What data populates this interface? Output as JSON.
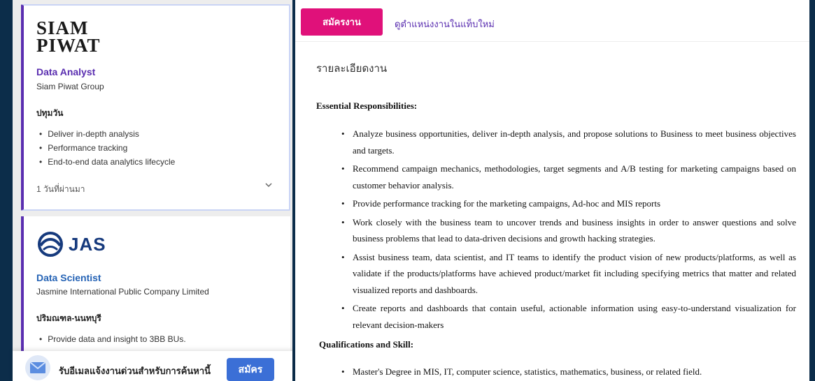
{
  "job_list": {
    "cards": [
      {
        "logo_text": "SIAM\nPIWAT",
        "title": "Data Analyst",
        "company": "Siam Piwat Group",
        "location": "ปทุมวัน",
        "highlights": [
          "Deliver in-depth analysis",
          "Performance tracking",
          "End-to-end data analytics lifecycle"
        ],
        "posted": "1 วันที่ผ่านมา"
      },
      {
        "logo_text": "JAS",
        "title": "Data Scientist",
        "company": "Jasmine International Public Company Limited",
        "location": "ปริมณฑล-นนทบุรี",
        "highlights": [
          "Provide data and insight to 3BB BUs."
        ]
      }
    ]
  },
  "subscribe": {
    "text": "รับอีเมลแจ้งงานด่วนสำหรับการค้นหานี้",
    "button": "สมัคร"
  },
  "detail": {
    "apply_button": "สมัครงาน",
    "new_tab_link": "ดูตำแหน่งงานในแท็บใหม่",
    "section_title": "รายละเอียดงาน",
    "responsibilities_heading": "Essential Responsibilities:",
    "responsibilities": [
      "Analyze business opportunities, deliver in-depth analysis, and propose solutions to Business to meet business objectives and targets.",
      "Recommend campaign mechanics, methodologies, target segments and A/B testing for marketing campaigns based on customer behavior analysis.",
      "Provide performance tracking for the marketing campaigns, Ad-hoc and MIS reports",
      "Work closely with the business team to uncover trends and business insights in order to answer questions and solve business problems that lead to data-driven decisions and growth hacking strategies.",
      "Assist business team, data scientist, and IT teams to identify the product vision of new products/platforms, as well as validate if the products/platforms have achieved product/market fit including specifying metrics that matter and related visualized reports and dashboards.",
      "Create reports and dashboards that contain useful, actionable information using easy-to-understand visualization for relevant decision-makers"
    ],
    "qualifications_heading": "Qualifications and Skill:",
    "qualifications": [
      "Master's Degree in MIS, IT, computer science, statistics, mathematics, business, or related field."
    ]
  },
  "colors": {
    "background": "#0c2d4a",
    "accent_purple": "#5a2eb0",
    "apply_pink": "#e0117a",
    "subscribe_blue": "#3b6fd6"
  },
  "icons": [
    "chevron-down-icon",
    "mail-icon",
    "jas-logo-icon"
  ]
}
